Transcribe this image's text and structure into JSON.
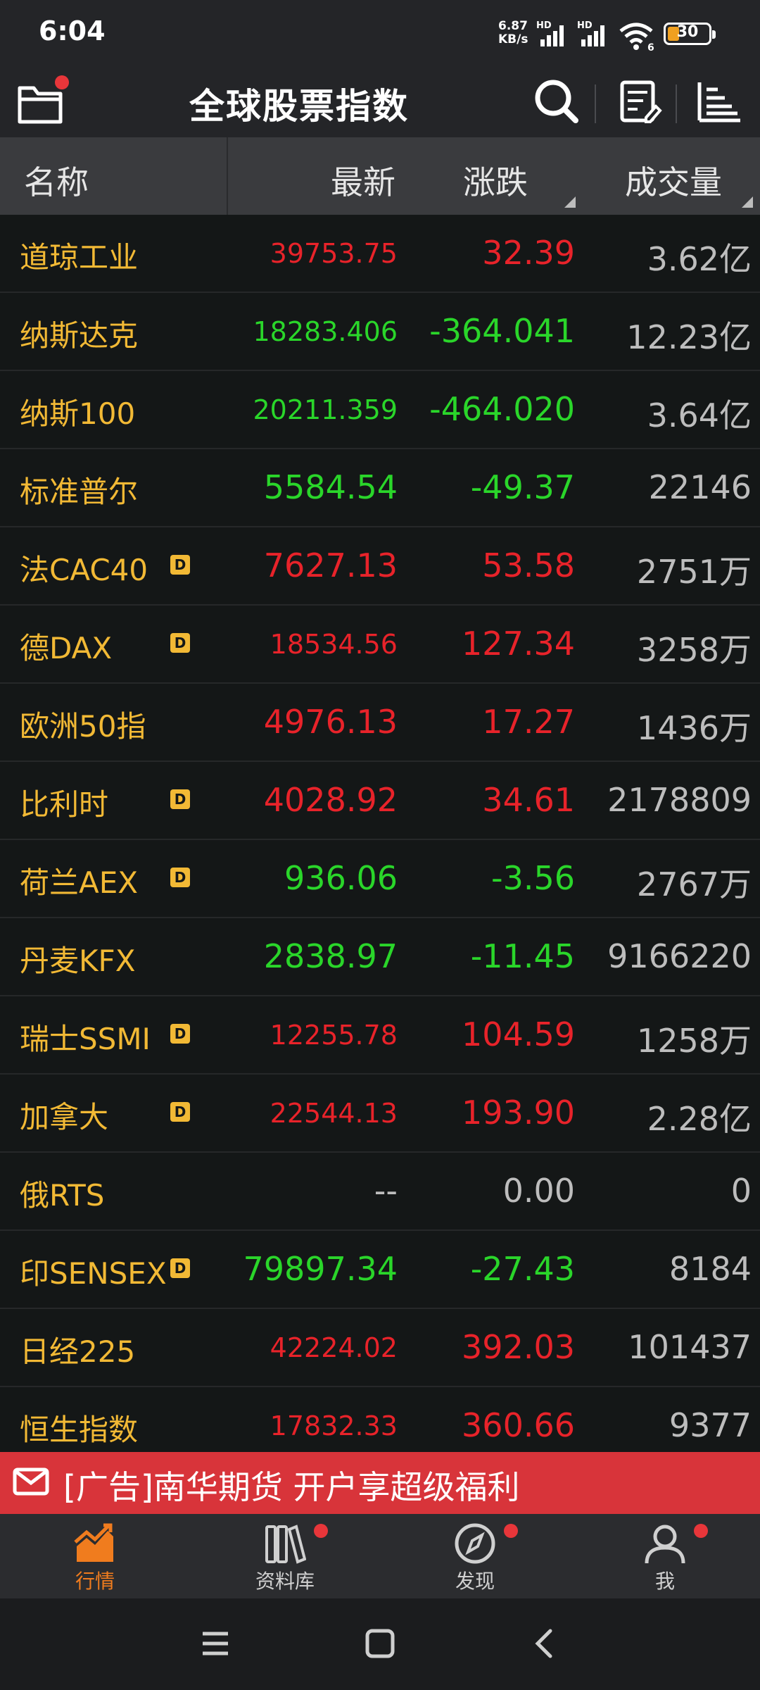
{
  "status_bar": {
    "time": "6:04",
    "net_speed": "6.87",
    "net_unit": "KB/s",
    "hd1": "HD",
    "hd2": "HD",
    "wifi_sub": "6",
    "battery": "30"
  },
  "header": {
    "title": "全球股票指数"
  },
  "table": {
    "columns": {
      "name": "名称",
      "last": "最新",
      "change": "涨跌",
      "volume": "成交量"
    },
    "rows": [
      {
        "name": "道琼工业",
        "badge": "",
        "last": "39753.75",
        "change": "32.39",
        "volume": "3.62亿",
        "dir": "up"
      },
      {
        "name": "纳斯达克",
        "badge": "",
        "last": "18283.406",
        "change": "-364.041",
        "volume": "12.23亿",
        "dir": "down"
      },
      {
        "name": "纳斯100",
        "badge": "",
        "last": "20211.359",
        "change": "-464.020",
        "volume": "3.64亿",
        "dir": "down"
      },
      {
        "name": "标准普尔",
        "badge": "",
        "last": "5584.54",
        "change": "-49.37",
        "volume": "22146",
        "dir": "down"
      },
      {
        "name": "法CAC40",
        "badge": "D",
        "last": "7627.13",
        "change": "53.58",
        "volume": "2751万",
        "dir": "up"
      },
      {
        "name": "德DAX",
        "badge": "D",
        "last": "18534.56",
        "change": "127.34",
        "volume": "3258万",
        "dir": "up"
      },
      {
        "name": "欧洲50指",
        "badge": "",
        "last": "4976.13",
        "change": "17.27",
        "volume": "1436万",
        "dir": "up"
      },
      {
        "name": "比利时",
        "badge": "D",
        "last": "4028.92",
        "change": "34.61",
        "volume": "2178809",
        "dir": "up"
      },
      {
        "name": "荷兰AEX",
        "badge": "D",
        "last": "936.06",
        "change": "-3.56",
        "volume": "2767万",
        "dir": "down"
      },
      {
        "name": "丹麦KFX",
        "badge": "",
        "last": "2838.97",
        "change": "-11.45",
        "volume": "9166220",
        "dir": "down"
      },
      {
        "name": "瑞士SSMI",
        "badge": "D",
        "last": "12255.78",
        "change": "104.59",
        "volume": "1258万",
        "dir": "up"
      },
      {
        "name": "加拿大",
        "badge": "D",
        "last": "22544.13",
        "change": "193.90",
        "volume": "2.28亿",
        "dir": "up"
      },
      {
        "name": "俄RTS",
        "badge": "",
        "last": "--",
        "change": "0.00",
        "volume": "0",
        "dir": "flat"
      },
      {
        "name": "印SENSEX",
        "badge": "D",
        "last": "79897.34",
        "change": "-27.43",
        "volume": "8184",
        "dir": "down"
      },
      {
        "name": "日经225",
        "badge": "",
        "last": "42224.02",
        "change": "392.03",
        "volume": "101437",
        "dir": "up"
      },
      {
        "name": "恒生指数",
        "badge": "",
        "last": "17832.33",
        "change": "360.66",
        "volume": "9377",
        "dir": "up"
      }
    ]
  },
  "ad": {
    "text": "[广告]南华期货 开户享超级福利"
  },
  "bottom_nav": {
    "tabs": [
      {
        "label": "行情",
        "icon": "chart-icon",
        "active": true
      },
      {
        "label": "资料库",
        "icon": "books-icon",
        "active": false
      },
      {
        "label": "发现",
        "icon": "compass-icon",
        "active": false
      },
      {
        "label": "我",
        "icon": "person-icon",
        "active": false
      }
    ]
  },
  "colors": {
    "up": "#e8232a",
    "down": "#2ad62a",
    "name": "#f2b935",
    "accent": "#f07c1e",
    "ad": "#d8343a"
  }
}
